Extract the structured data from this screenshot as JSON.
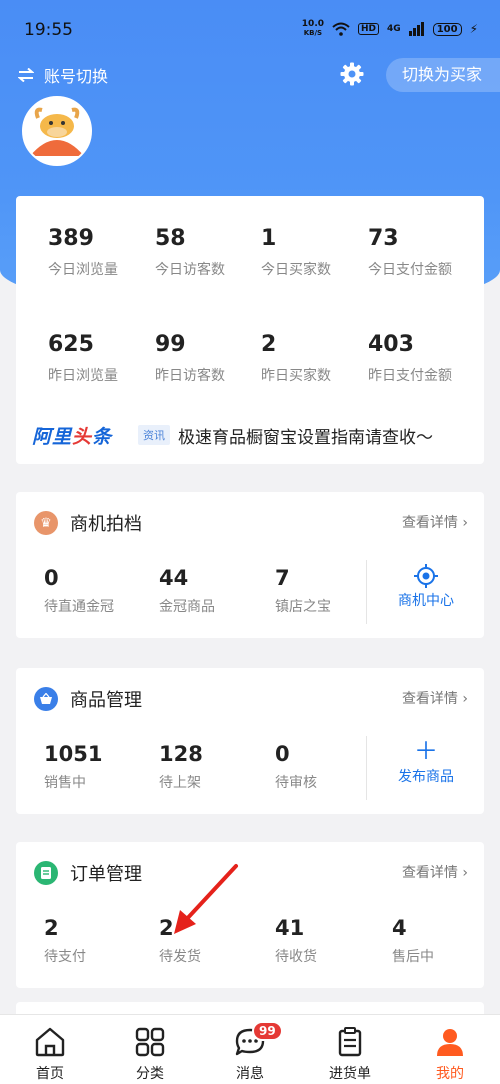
{
  "status_bar": {
    "time": "19:55",
    "speed_value": "10.0",
    "speed_unit": "KB/S",
    "hd": "HD",
    "network": "4G",
    "battery": "100"
  },
  "header": {
    "switch_account": "账号切换",
    "switch_to_buyer": "切换为买家",
    "settings_icon": "gear-icon"
  },
  "stats": {
    "today": [
      {
        "value": "389",
        "label": "今日浏览量"
      },
      {
        "value": "58",
        "label": "今日访客数"
      },
      {
        "value": "1",
        "label": "今日买家数"
      },
      {
        "value": "73",
        "label": "今日支付金额"
      }
    ],
    "yesterday": [
      {
        "value": "625",
        "label": "昨日浏览量"
      },
      {
        "value": "99",
        "label": "昨日访客数"
      },
      {
        "value": "2",
        "label": "昨日买家数"
      },
      {
        "value": "403",
        "label": "昨日支付金额"
      }
    ],
    "news": {
      "logo_part1": "阿里",
      "logo_part2": "头",
      "logo_part3": "条",
      "tag": "资讯",
      "text": "极速育品橱窗宝设置指南请查收～"
    }
  },
  "opportunity": {
    "title": "商机拍档",
    "detail": "查看详情",
    "metrics": [
      {
        "value": "0",
        "label": "待直通金冠"
      },
      {
        "value": "44",
        "label": "金冠商品"
      },
      {
        "value": "7",
        "label": "镇店之宝"
      }
    ],
    "action": "商机中心",
    "colors": {
      "icon_bg": "#e8956a"
    }
  },
  "product": {
    "title": "商品管理",
    "detail": "查看详情",
    "metrics": [
      {
        "value": "1051",
        "label": "销售中"
      },
      {
        "value": "128",
        "label": "待上架"
      },
      {
        "value": "0",
        "label": "待审核"
      }
    ],
    "action": "发布商品",
    "colors": {
      "icon_bg": "#3a7fe8"
    }
  },
  "orders": {
    "title": "订单管理",
    "detail": "查看详情",
    "metrics": [
      {
        "value": "2",
        "label": "待支付"
      },
      {
        "value": "2",
        "label": "待发货"
      },
      {
        "value": "41",
        "label": "待收货"
      },
      {
        "value": "4",
        "label": "售后中"
      }
    ],
    "colors": {
      "icon_bg": "#2bb673"
    }
  },
  "tabbar": {
    "items": [
      {
        "label": "首页",
        "icon": "home-icon"
      },
      {
        "label": "分类",
        "icon": "grid-icon"
      },
      {
        "label": "消息",
        "icon": "chat-icon",
        "badge": "99"
      },
      {
        "label": "进货单",
        "icon": "clipboard-icon"
      },
      {
        "label": "我的",
        "icon": "person-icon",
        "active": true
      }
    ]
  },
  "colors": {
    "brand_blue": "#4a8df5",
    "accent_orange": "#ff5a1f",
    "link_blue": "#1a73e8"
  }
}
